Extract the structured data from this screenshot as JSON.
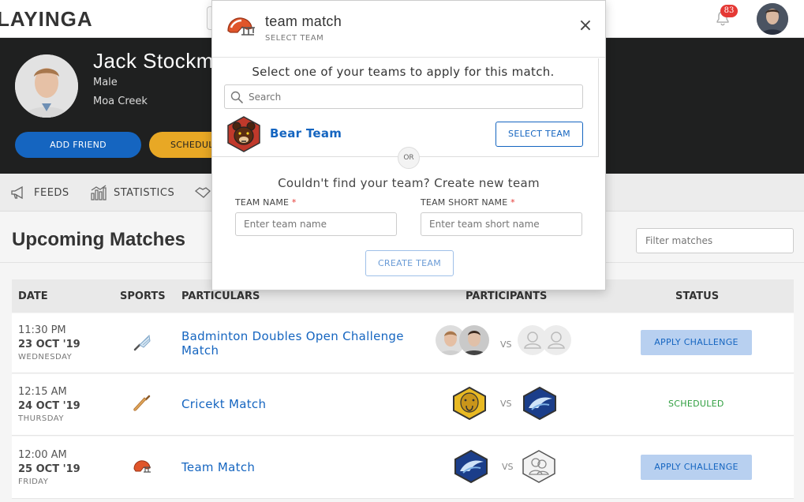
{
  "topnav": {
    "logo": "LAYINGA",
    "notification_count": "83"
  },
  "profile": {
    "name": "Jack Stockman",
    "gender": "Male",
    "location": "Moa Creek",
    "add_friend_label": "ADD FRIEND",
    "schedule_label": "SCHEDULE"
  },
  "tabs": [
    {
      "label": "FEEDS",
      "icon": "megaphone-icon"
    },
    {
      "label": "STATISTICS",
      "icon": "bar-chart-icon"
    },
    {
      "label": "",
      "icon": "handshake-icon"
    }
  ],
  "upcoming": {
    "title": "Upcoming Matches",
    "filter_placeholder": "Filter matches",
    "headers": {
      "date": "DATE",
      "sports": "SPORTS",
      "particulars": "PARTICULARS",
      "participants": "PARTICIPANTS",
      "status": "STATUS"
    },
    "rows": [
      {
        "time": "11:30 PM",
        "date": "23 OCT '19",
        "day": "WEDNESDAY",
        "sport": "badminton",
        "particulars": "Badminton Doubles Open Challenge Match",
        "vs": "VS",
        "status": "APPLY CHALLENGE"
      },
      {
        "time": "12:15 AM",
        "date": "24 OCT '19",
        "day": "THURSDAY",
        "sport": "cricket",
        "particulars": "Cricekt Match",
        "vs": "VS",
        "status": "SCHEDULED"
      },
      {
        "time": "12:00 AM",
        "date": "25 OCT '19",
        "day": "FRIDAY",
        "sport": "football",
        "particulars": "Team Match",
        "vs": "VS",
        "status": "APPLY CHALLENGE"
      }
    ]
  },
  "modal": {
    "title": "team match",
    "subtitle": "SELECT TEAM",
    "close_label": "×",
    "instruction": "Select one of your teams to apply for this match.",
    "search_placeholder": "Search",
    "team": {
      "name": "Bear Team",
      "button_label": "SELECT TEAM"
    },
    "or_label": "OR",
    "create_heading": "Couldn't find your team? Create new team",
    "team_name_label": "TEAM NAME",
    "team_name_placeholder": "Enter team name",
    "team_short_label": "TEAM SHORT NAME",
    "team_short_placeholder": "Enter team short name",
    "required_mark": "*",
    "create_button": "CREATE TEAM"
  },
  "colors": {
    "accent": "#1565c0",
    "banner": "#1f2020",
    "schedule": "#e8a825",
    "scheduled_status": "#2e9e3e",
    "badge": "#e53935"
  }
}
